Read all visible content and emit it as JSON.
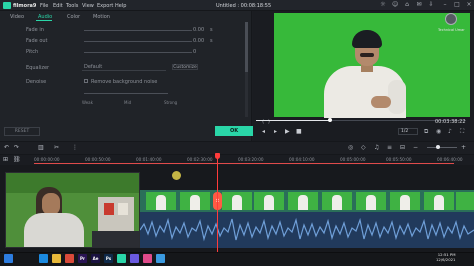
{
  "titlebar": {
    "brand": "filmora9",
    "menu": [
      "File",
      "Edit",
      "Tools",
      "View",
      "Export",
      "Help"
    ],
    "document_title": "Untitled : 00:08:18:55"
  },
  "tabs": [
    {
      "label": "Video"
    },
    {
      "label": "Audio"
    },
    {
      "label": "Color"
    },
    {
      "label": "Motion"
    }
  ],
  "audio_settings": {
    "fade_in": {
      "label": "Fade in",
      "value": "0.00",
      "unit": "s"
    },
    "fade_out": {
      "label": "Fade out",
      "value": "0.00",
      "unit": "s"
    },
    "pitch": {
      "label": "Pitch",
      "value": "0"
    },
    "equalizer": {
      "label": "Equalizer",
      "value": "Default",
      "customize_label": "Customize"
    },
    "denoise": {
      "label": "Denoise",
      "checkbox_label": "Remove background noise"
    },
    "denoise_levels": [
      "Weak",
      "Mid",
      "Strong"
    ]
  },
  "buttons": {
    "reset": "RESET",
    "ok": "OK"
  },
  "preview": {
    "channel_name": "Technical Umar",
    "timecode": "00:03:38:22",
    "ratio": "1/2",
    "progress": 0.35
  },
  "timeline": {
    "timecodes": [
      "00:00:00:00",
      "00:00:50:00",
      "00:01:40:00",
      "00:02:30:00",
      "00:03:20:00",
      "00:04:10:00",
      "00:05:00:00",
      "00:05:50:00",
      "00:06:40:00",
      "00:07:30:00",
      "00:08:20:00"
    ]
  },
  "taskbar": {
    "apps": [
      {
        "name": "windows-icon",
        "color": "#2d7de0",
        "label": ""
      },
      {
        "name": "edge-icon",
        "color": "#1b8ae0",
        "label": ""
      },
      {
        "name": "folder-icon",
        "color": "#e8b93a",
        "label": ""
      },
      {
        "name": "chrome-icon",
        "color": "#d94a3a",
        "label": ""
      },
      {
        "name": "premiere-icon",
        "color": "#2a1454",
        "label": "Pr"
      },
      {
        "name": "after-effects-icon",
        "color": "#1a1240",
        "label": "Ae"
      },
      {
        "name": "photoshop-icon",
        "color": "#0f2a4a",
        "label": "Ps"
      },
      {
        "name": "filmora-icon",
        "color": "#2ad6a8",
        "label": ""
      },
      {
        "name": "app-icon-1",
        "color": "#6a5ae0",
        "label": ""
      },
      {
        "name": "app-icon-2",
        "color": "#e04a8a",
        "label": ""
      },
      {
        "name": "app-icon-3",
        "color": "#3a9ae0",
        "label": ""
      }
    ],
    "time": "12:51 PM",
    "date": "12/6/2021"
  },
  "colors": {
    "accent": "#2ad6a8",
    "playhead": "#ff3b3b",
    "greenscreen": "#37b93a"
  }
}
